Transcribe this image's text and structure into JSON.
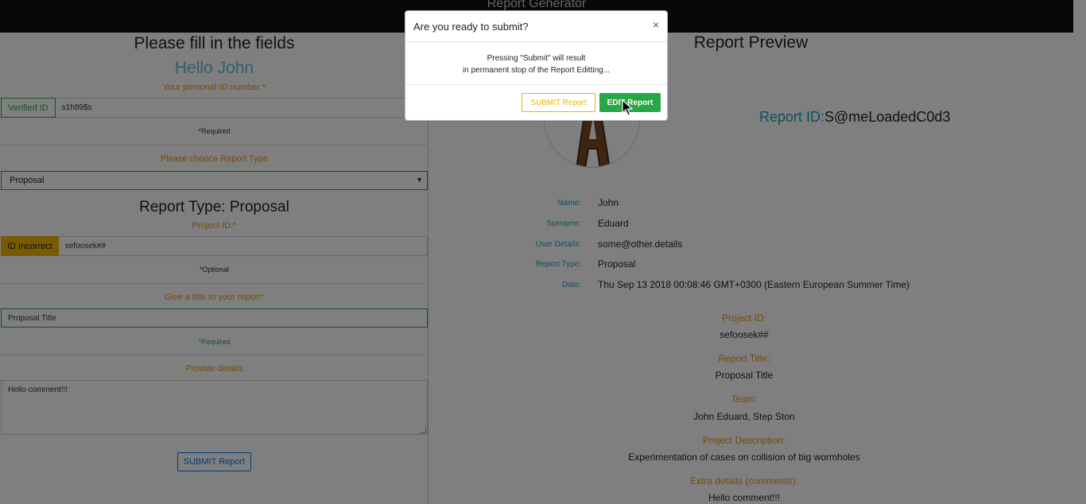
{
  "app": {
    "title": "Report Generator"
  },
  "form": {
    "heading": "Please fill in the fields",
    "greeting": "Hello John",
    "personal_id_label": "Your personal ID number:*",
    "personal_id_addon": "Verified ID",
    "personal_id_value": "s1h89$s",
    "personal_id_note": "*Required",
    "report_type_label": "Please chooce Report Type",
    "report_type_value": "Proposal",
    "report_type_heading": "Report Type: Proposal",
    "project_id_label": "Project ID:*",
    "project_id_addon": "ID Incorrect",
    "project_id_value": "sefoosek##",
    "project_id_note": "*Optional",
    "title_label": "Give a title to your report*",
    "title_value": "Proposal Title",
    "title_note": "*Required",
    "details_label": "Provide details",
    "details_value": "Hello comment!!!",
    "submit_label": "SUBMIT Report"
  },
  "preview": {
    "heading": "Report Preview",
    "report_id_label": "Report ID:",
    "report_id_value": "S@meLoadedC0d3",
    "details": [
      {
        "label": "Name:",
        "value": "John"
      },
      {
        "label": "Surname:",
        "value": "Eduard"
      },
      {
        "label": "User Details:",
        "value": "some@other.details"
      },
      {
        "label": "Report Type:",
        "value": "Proposal"
      },
      {
        "label": "Date:",
        "value": "Thu Sep 13 2018 00:08:46 GMT+0300 (Eastern European Summer Time)"
      }
    ],
    "sections": [
      {
        "label": "Project ID:",
        "value": "sefoosek##"
      },
      {
        "label": "Report Title:",
        "value": "Proposal Title"
      },
      {
        "label": "Team:",
        "value": "John Eduard, Step Ston"
      },
      {
        "label": "Project Description:",
        "value": "Experimentation of cases on collision of big wormholes"
      },
      {
        "label": "Extra details (comments):",
        "value": "Hello comment!!!"
      }
    ],
    "avatar_letter": "A"
  },
  "modal": {
    "title": "Are you ready to submit?",
    "close": "×",
    "body_line1": "Pressing \"Submit\" will result",
    "body_line2": "in permanent stop of the Report Editting...",
    "submit_label": "SUBMIT Report",
    "edit_label": "EDIT Report"
  },
  "colors": {
    "accent_orange": "#e8960e",
    "accent_teal": "#17a2b8",
    "success": "#28a745",
    "warning": "#f0b400",
    "primary": "#007bff"
  }
}
